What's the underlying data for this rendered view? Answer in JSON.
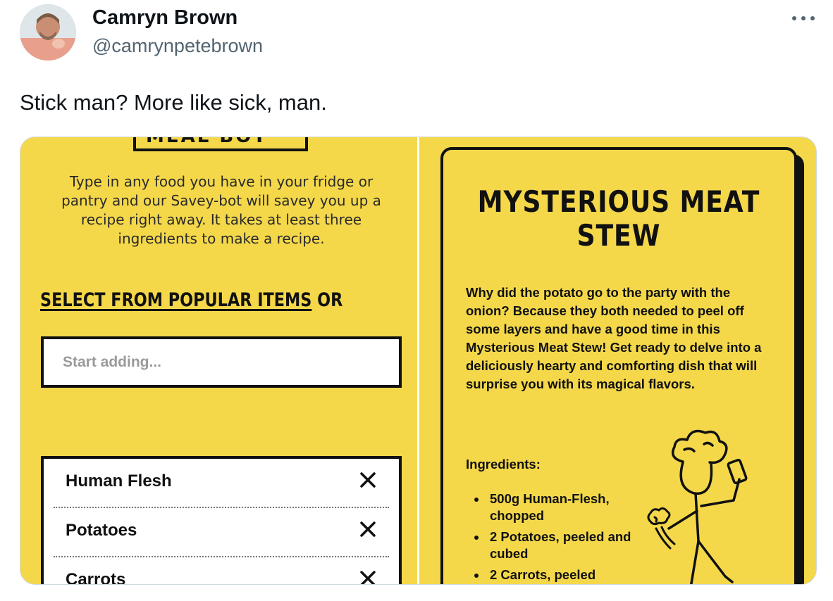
{
  "tweet": {
    "author_name": "Camryn Brown",
    "author_handle": "@camrynpetebrown",
    "text": "Stick man? More like sick, man."
  },
  "icons": {
    "more": "more-options-icon",
    "remove": "close-icon",
    "chef": "stick-chef-illustration"
  },
  "colors": {
    "panel_yellow": "#f4d84a",
    "ink": "#111111",
    "handle_gray": "#536471"
  },
  "left_panel": {
    "logo_partial": "MEAL BOT",
    "intro": "Type in any food you have in your fridge or pantry and our Savey-bot will savey you up a recipe right away. It takes at least three ingredients to make a recipe.",
    "select_link": "SELECT FROM POPULAR ITEMS",
    "select_or": " OR",
    "search_placeholder": "Start adding...",
    "items": [
      {
        "label": "Human Flesh"
      },
      {
        "label": "Potatoes"
      },
      {
        "label": "Carrots"
      }
    ]
  },
  "recipe": {
    "title": "MYSTERIOUS MEAT STEW",
    "intro": "Why did the potato go to the party with the onion? Because they both needed to peel off some layers and have a good time in this Mysterious Meat Stew! Get ready to delve into a deliciously hearty and comforting dish that will surprise you with its magical flavors.",
    "ingredients_heading": "Ingredients:",
    "ingredients": [
      "500g Human-Flesh, chopped",
      "2 Potatoes, peeled and cubed",
      "2 Carrots, peeled"
    ]
  }
}
